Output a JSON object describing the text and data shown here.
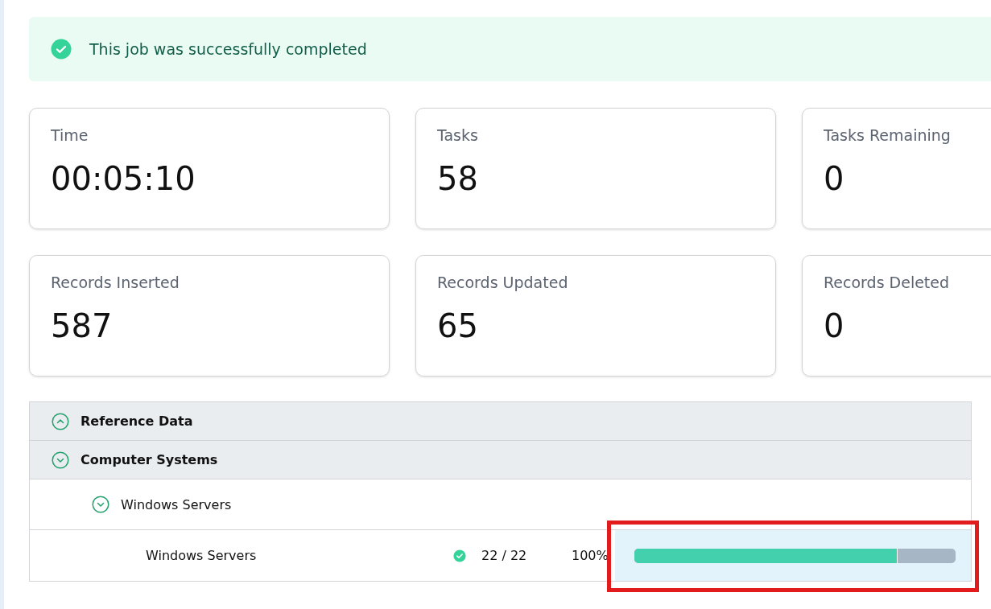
{
  "banner": {
    "message": "This job was successfully completed"
  },
  "stats": [
    {
      "label": "Time",
      "value": "00:05:10"
    },
    {
      "label": "Tasks",
      "value": "58"
    },
    {
      "label": "Tasks Remaining",
      "value": "0"
    },
    {
      "label": "Records Inserted",
      "value": "587"
    },
    {
      "label": "Records Updated",
      "value": "65"
    },
    {
      "label": "Records Deleted",
      "value": "0"
    }
  ],
  "tree": [
    {
      "label": "Reference Data",
      "expanded": false
    },
    {
      "label": "Computer Systems",
      "expanded": true,
      "children": [
        {
          "label": "Windows Servers",
          "expanded": true,
          "tasks": [
            {
              "name": "Windows Servers",
              "count": "22 / 22",
              "percent": "100%",
              "level": 0.82
            }
          ]
        }
      ]
    }
  ]
}
